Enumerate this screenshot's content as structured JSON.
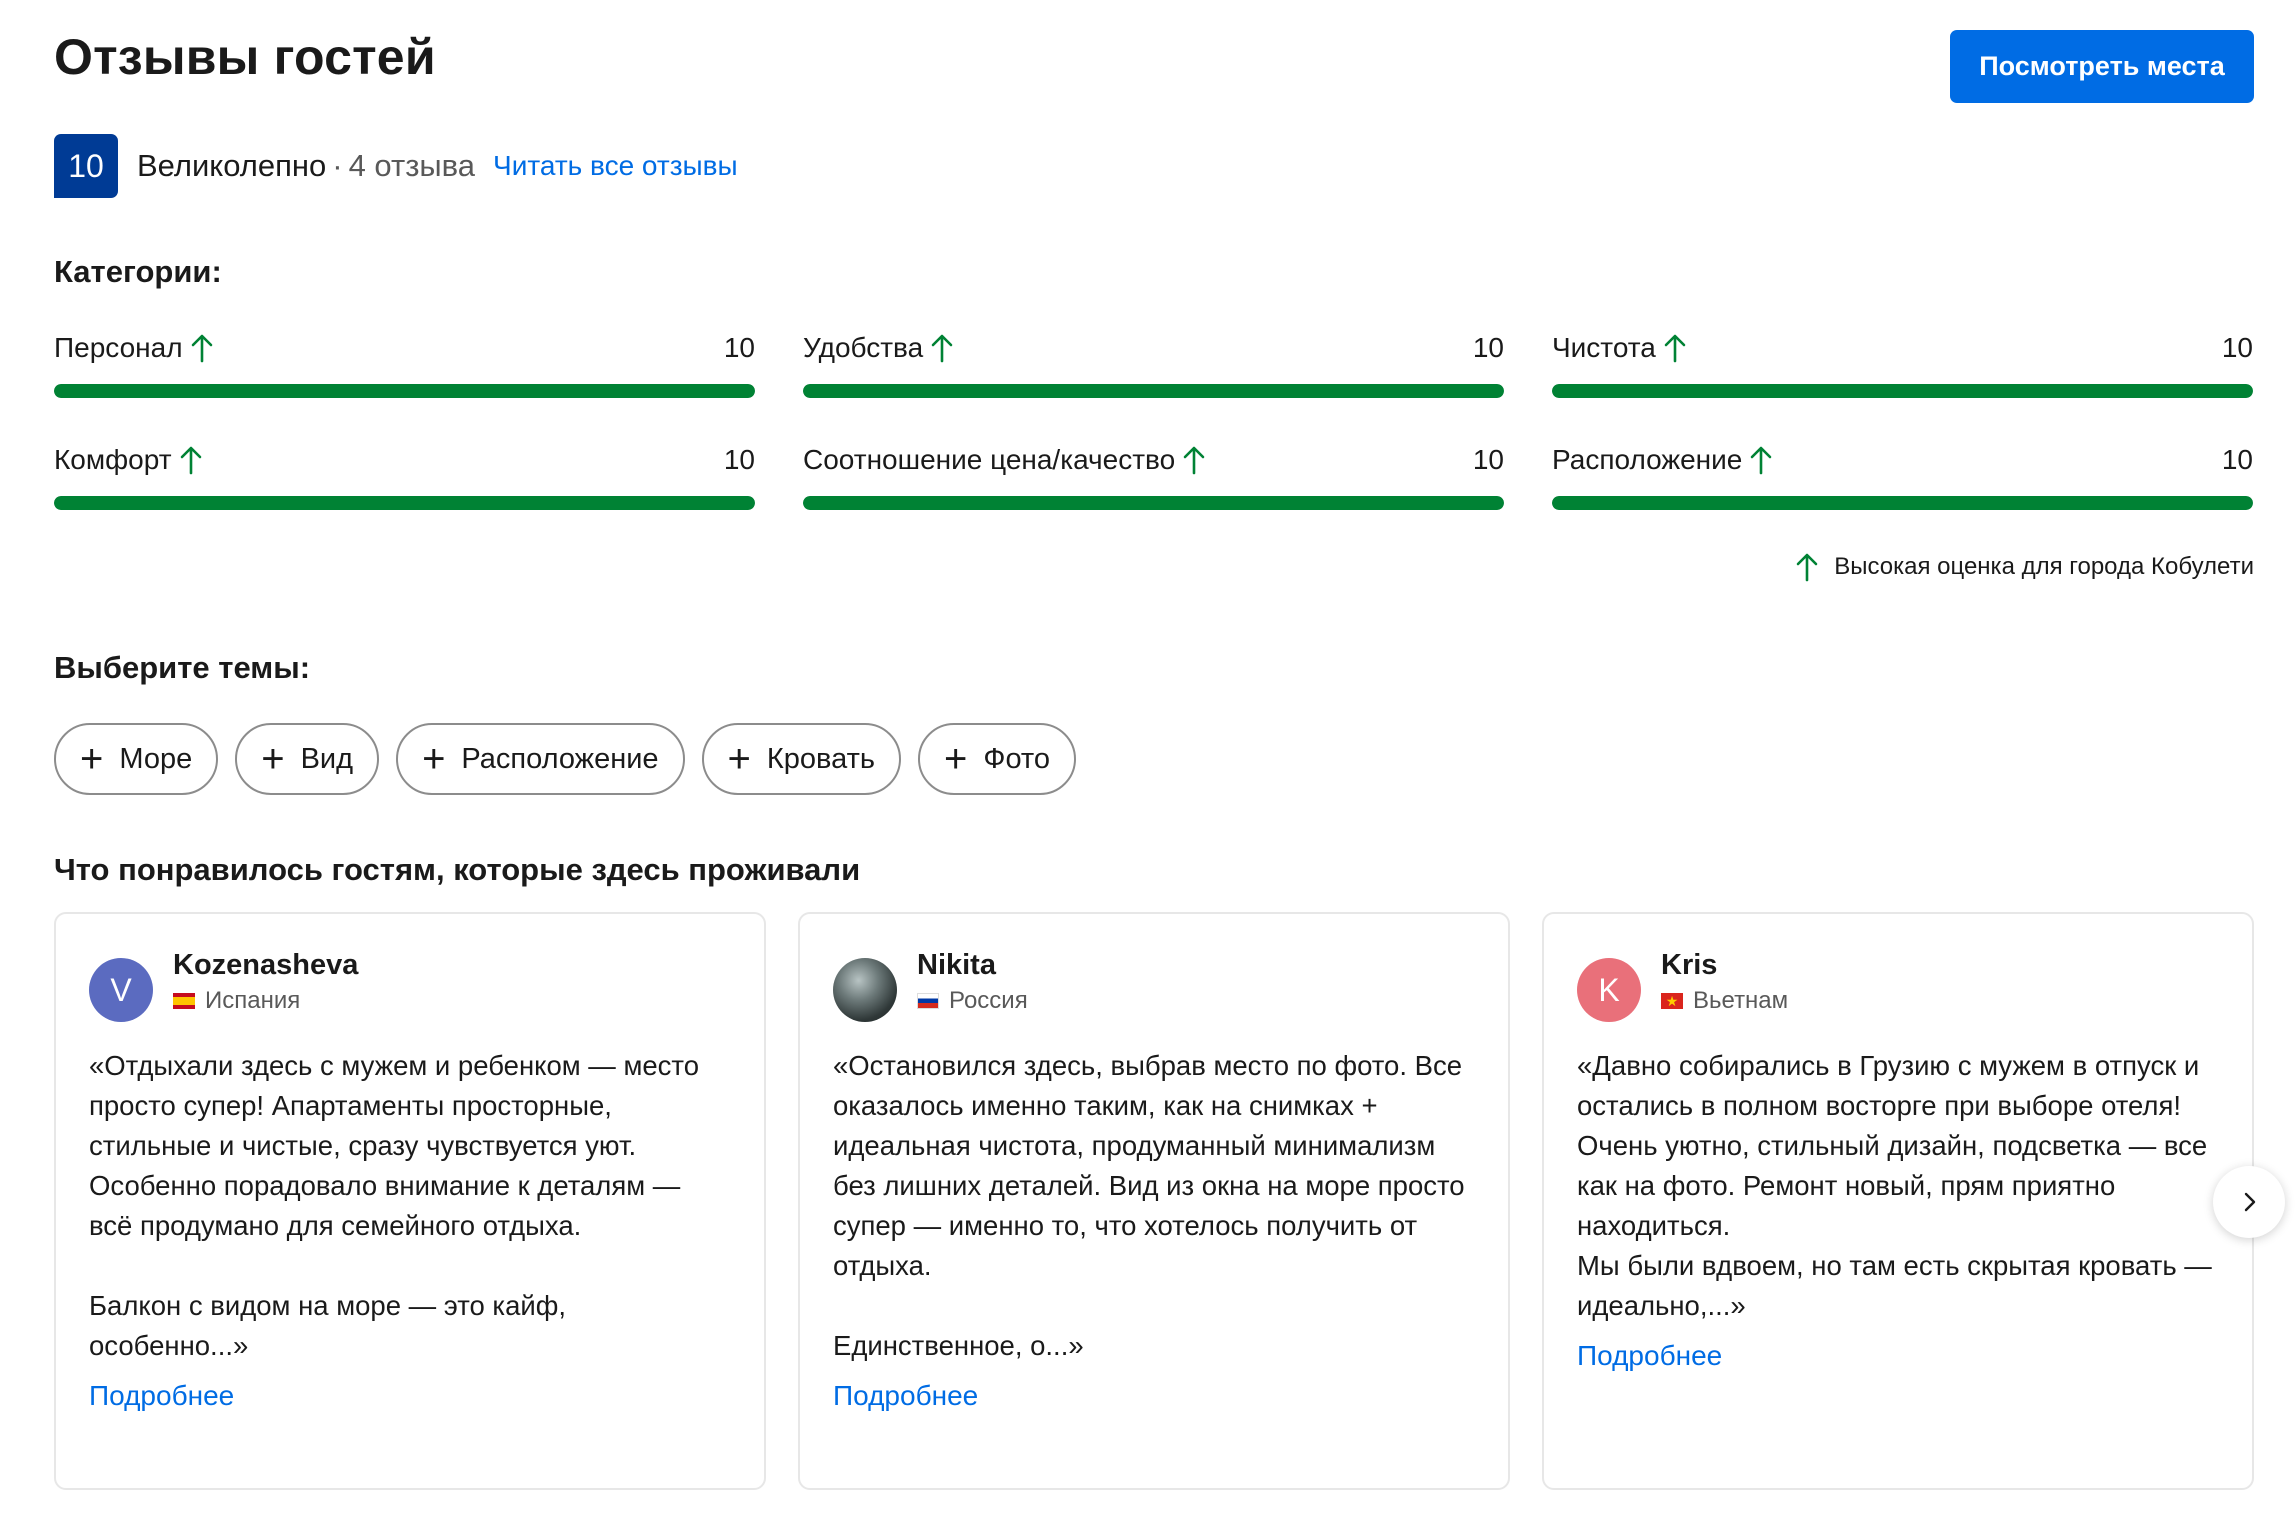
{
  "header": {
    "title": "Отзывы гостей",
    "see_places_label": "Посмотреть места"
  },
  "score": {
    "value": "10",
    "word": "Великолепно",
    "separator": "·",
    "count": "4 отзыва",
    "read_all_label": "Читать все отзывы"
  },
  "categories": {
    "title": "Категории:",
    "items": [
      {
        "label": "Персонал",
        "value": "10",
        "fraction": 1.0
      },
      {
        "label": "Удобства",
        "value": "10",
        "fraction": 1.0
      },
      {
        "label": "Чистота",
        "value": "10",
        "fraction": 1.0
      },
      {
        "label": "Комфорт",
        "value": "10",
        "fraction": 1.0
      },
      {
        "label": "Соотношение цена/качество",
        "value": "10",
        "fraction": 1.0
      },
      {
        "label": "Расположение",
        "value": "10",
        "fraction": 1.0
      }
    ],
    "city_note": "Высокая оценка для города Кобулети"
  },
  "topics": {
    "title": "Выберите темы:",
    "chips": [
      "Море",
      "Вид",
      "Расположение",
      "Кровать",
      "Фото"
    ]
  },
  "reviews": {
    "title": "Что понравилось гостям, которые здесь проживали",
    "more_label": "Подробнее",
    "items": [
      {
        "initial": "V",
        "avatar_color": "#5b6bc0",
        "name": "Kozenasheva",
        "country": "Испания",
        "text": "«Отдыхали здесь с мужем и ребенком — место просто супер! Апартаменты просторные, стильные и чистые, сразу чувствуется уют. Особенно порадовало внимание к деталям — всё продумано для семейного отдыха.\n\nБалкон с видом на море — это кайф, особенно...»"
      },
      {
        "initial": "",
        "avatar_color": "#4a5555",
        "name": "Nikita",
        "country": "Россия",
        "text": "«Остановился здесь, выбрав место по фото. Все оказалось именно таким, как на снимках + идеальная чистота, продуманный минимализм без лишних деталей. Вид из окна на море просто супер — именно то, что хотелось получить от отдыха.\n\nЕдинственное, о...»"
      },
      {
        "initial": "K",
        "avatar_color": "#e9707a",
        "name": "Kris",
        "country": "Вьетнам",
        "text": "«Давно собирались в Грузию с мужем в отпуск и остались в полном восторге при выборе отеля!Очень уютно, стильный дизайн, подсветка — все как на фото. Ремонт новый, прям приятно находиться.\nМы были вдвоем, но там есть скрытая кровать — идеально,...»"
      }
    ]
  },
  "colors": {
    "accent": "#006ce4",
    "score_badge": "#003b95",
    "bar_fill": "#008234"
  }
}
